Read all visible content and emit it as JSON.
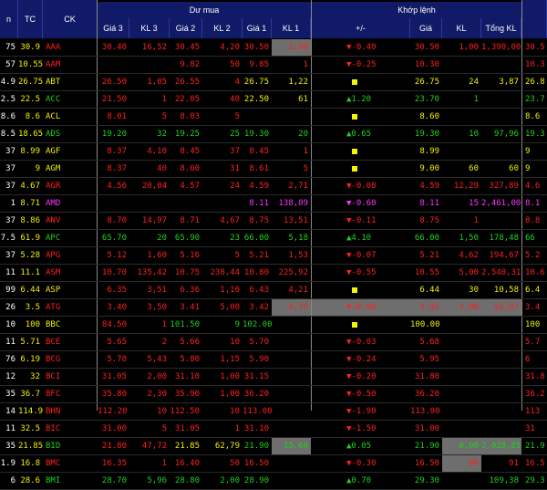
{
  "colors": {
    "up": "#1ed11e",
    "down": "#ff1f1f",
    "ref": "#f0f000",
    "ceil": "#ff33ff",
    "header_bg": "#111a66",
    "tc": "#f0f000"
  },
  "header": {
    "groups": {
      "buy": "Dư mua",
      "match": "Khớp lệnh"
    },
    "cols": {
      "prev": "n",
      "tc": "TC",
      "ck": "CK",
      "gia3": "Giá 3",
      "kl3": "KL 3",
      "gia2": "Giá 2",
      "kl2": "KL 2",
      "gia1": "Giá 1",
      "kl1": "KL 1",
      "change": "+/-",
      "gia": "Giá",
      "kl": "KL",
      "tongkl": "Tổng KL"
    }
  },
  "rows": [
    {
      "prev": "75",
      "tc": "30.9",
      "ck": "AAA",
      "gia3": "30.40",
      "kl3": "16,52",
      "gia2": "30.45",
      "kl2": "4,20",
      "gia1": "30.50",
      "kl1": "1,80",
      "change": "▼-0.40",
      "gia": "30.50",
      "kl": "1,00",
      "tongkl": "1,390,00",
      "right": "30.5",
      "hl": [
        "kl1"
      ],
      "tone": {
        "gia3": "down",
        "kl3": "down",
        "gia2": "down",
        "kl2": "down",
        "gia1": "down",
        "kl1": "down",
        "ck": "down",
        "change": "down",
        "gia": "down",
        "kl": "down",
        "tongkl": "down",
        "right": "down"
      }
    },
    {
      "prev": "57",
      "tc": "10.55",
      "ck": "AAM",
      "gia3": "",
      "kl3": "",
      "gia2": "9.82",
      "kl2": "50",
      "gia1": "9.85",
      "kl1": "1",
      "change": "▼-0.25",
      "gia": "10.30",
      "kl": "",
      "tongkl": "",
      "right": "10.3",
      "tone": {
        "gia2": "down",
        "kl2": "down",
        "gia1": "down",
        "kl1": "down",
        "ck": "down",
        "change": "down",
        "gia": "down",
        "kl": "down",
        "tongkl": "down",
        "right": "down"
      }
    },
    {
      "prev": "4.9",
      "tc": "26.75",
      "ck": "ABT",
      "gia3": "26.50",
      "kl3": "1,05",
      "gia2": "26.55",
      "kl2": "4",
      "gia1": "26.75",
      "kl1": "1,22",
      "change": "■",
      "gia": "26.75",
      "kl": "24",
      "tongkl": "3,87",
      "right": "26.8",
      "tone": {
        "gia3": "down",
        "kl3": "down",
        "gia2": "down",
        "kl2": "down",
        "gia1": "ref",
        "kl1": "ref",
        "ck": "ref",
        "change": "ref",
        "gia": "ref",
        "kl": "ref",
        "tongkl": "ref",
        "right": "ref"
      }
    },
    {
      "prev": "2.5",
      "tc": "22.5",
      "ck": "ACC",
      "gia3": "21.50",
      "kl3": "1",
      "gia2": "22.05",
      "kl2": "40",
      "gia1": "22.50",
      "kl1": "61",
      "change": "▲1.20",
      "gia": "23.70",
      "kl": "1",
      "tongkl": "",
      "right": "23.7",
      "tone": {
        "gia3": "down",
        "kl3": "down",
        "gia2": "down",
        "kl2": "down",
        "gia1": "ref",
        "kl1": "ref",
        "ck": "up",
        "change": "up",
        "gia": "up",
        "kl": "up",
        "tongkl": "up",
        "right": "up"
      }
    },
    {
      "prev": "8.6",
      "tc": "8.6",
      "ck": "ACL",
      "gia3": "8.01",
      "kl3": "5",
      "gia2": "8.03",
      "kl2": "5",
      "gia1": "",
      "kl1": "",
      "change": "■",
      "gia": "8.60",
      "kl": "",
      "tongkl": "",
      "right": "8.6",
      "tone": {
        "gia3": "down",
        "kl3": "down",
        "gia2": "down",
        "kl2": "down",
        "ck": "ref",
        "change": "ref",
        "gia": "ref",
        "kl": "ref",
        "tongkl": "ref",
        "right": "ref"
      }
    },
    {
      "prev": "8.5",
      "tc": "18.65",
      "ck": "ADS",
      "gia3": "19.20",
      "kl3": "32",
      "gia2": "19.25",
      "kl2": "25",
      "gia1": "19.30",
      "kl1": "20",
      "change": "▲0.65",
      "gia": "19.30",
      "kl": "10",
      "tongkl": "97,96",
      "right": "19.3",
      "tone": {
        "gia3": "up",
        "kl3": "up",
        "gia2": "up",
        "kl2": "up",
        "gia1": "up",
        "kl1": "up",
        "ck": "up",
        "change": "up",
        "gia": "up",
        "kl": "up",
        "tongkl": "up",
        "right": "up"
      }
    },
    {
      "prev": "37",
      "tc": "8.99",
      "ck": "AGF",
      "gia3": "8.37",
      "kl3": "4,10",
      "gia2": "8.45",
      "kl2": "37",
      "gia1": "8.45",
      "kl1": "1",
      "change": "■",
      "gia": "8.99",
      "kl": "",
      "tongkl": "",
      "right": "9",
      "tone": {
        "gia3": "down",
        "kl3": "down",
        "gia2": "down",
        "kl2": "down",
        "gia1": "down",
        "kl1": "down",
        "ck": "ref",
        "change": "ref",
        "gia": "ref",
        "kl": "ref",
        "tongkl": "ref",
        "right": "ref"
      }
    },
    {
      "prev": "37",
      "tc": "9",
      "ck": "AGM",
      "gia3": "8.37",
      "kl3": "40",
      "gia2": "8.60",
      "kl2": "31",
      "gia1": "8.61",
      "kl1": "5",
      "change": "■",
      "gia": "9.00",
      "kl": "60",
      "tongkl": "60",
      "right": "9",
      "tone": {
        "gia3": "down",
        "kl3": "down",
        "gia2": "down",
        "kl2": "down",
        "gia1": "down",
        "kl1": "down",
        "ck": "ref",
        "change": "ref",
        "gia": "ref",
        "kl": "ref",
        "tongkl": "ref",
        "right": "ref"
      }
    },
    {
      "prev": "37",
      "tc": "4.67",
      "ck": "AGR",
      "gia3": "4.56",
      "kl3": "20,04",
      "gia2": "4.57",
      "kl2": "24",
      "gia1": "4.59",
      "kl1": "2,71",
      "change": "▼-0.08",
      "gia": "4.59",
      "kl": "12,29",
      "tongkl": "327,89",
      "right": "4.6",
      "tone": {
        "gia3": "down",
        "kl3": "down",
        "gia2": "down",
        "kl2": "down",
        "gia1": "down",
        "kl1": "down",
        "ck": "down",
        "change": "down",
        "gia": "down",
        "kl": "down",
        "tongkl": "down",
        "right": "down"
      }
    },
    {
      "prev": "1",
      "tc": "8.71",
      "ck": "AMD",
      "gia3": "",
      "kl3": "",
      "gia2": "",
      "kl2": "",
      "gia1": "8.11",
      "kl1": "138,09",
      "change": "▼-0.60",
      "gia": "8.11",
      "kl": "15",
      "tongkl": "2,461,00",
      "right": "8.1",
      "tone": {
        "gia1": "ceil",
        "kl1": "ceil",
        "ck": "ceil",
        "change": "ceil",
        "gia": "ceil",
        "kl": "ceil",
        "tongkl": "ceil",
        "right": "ceil"
      }
    },
    {
      "prev": "37",
      "tc": "8.86",
      "ck": "ANV",
      "gia3": "8.70",
      "kl3": "14,97",
      "gia2": "8.71",
      "kl2": "4,67",
      "gia1": "8.75",
      "kl1": "13,51",
      "change": "▼-0.11",
      "gia": "8.75",
      "kl": "1",
      "tongkl": "",
      "right": "8.8",
      "tone": {
        "gia3": "down",
        "kl3": "down",
        "gia2": "down",
        "kl2": "down",
        "gia1": "down",
        "kl1": "down",
        "ck": "down",
        "change": "down",
        "gia": "down",
        "kl": "down",
        "tongkl": "down",
        "right": "down"
      }
    },
    {
      "prev": "7.5",
      "tc": "61.9",
      "ck": "APC",
      "gia3": "65.70",
      "kl3": "20",
      "gia2": "65.90",
      "kl2": "23",
      "gia1": "66.00",
      "kl1": "5,18",
      "change": "▲4.10",
      "gia": "66.00",
      "kl": "1,50",
      "tongkl": "178,48",
      "right": "66",
      "tone": {
        "gia3": "up",
        "kl3": "up",
        "gia2": "up",
        "kl2": "up",
        "gia1": "up",
        "kl1": "up",
        "ck": "up",
        "change": "up",
        "gia": "up",
        "kl": "up",
        "tongkl": "up",
        "right": "up"
      }
    },
    {
      "prev": "37",
      "tc": "5.28",
      "ck": "APG",
      "gia3": "5.12",
      "kl3": "1,60",
      "gia2": "5.16",
      "kl2": "5",
      "gia1": "5.21",
      "kl1": "1,53",
      "change": "▼-0.07",
      "gia": "5.21",
      "kl": "4,62",
      "tongkl": "194,67",
      "right": "5.2",
      "tone": {
        "gia3": "down",
        "kl3": "down",
        "gia2": "down",
        "kl2": "down",
        "gia1": "down",
        "kl1": "down",
        "ck": "down",
        "change": "down",
        "gia": "down",
        "kl": "down",
        "tongkl": "down",
        "right": "down"
      }
    },
    {
      "prev": "11",
      "tc": "11.1",
      "ck": "ASM",
      "gia3": "10.70",
      "kl3": "135,42",
      "gia2": "10.75",
      "kl2": "238,44",
      "gia1": "10.80",
      "kl1": "225,92",
      "change": "▼-0.55",
      "gia": "10.55",
      "kl": "5,00",
      "tongkl": "2,540,31",
      "right": "10.6",
      "tone": {
        "gia3": "down",
        "kl3": "down",
        "gia2": "down",
        "kl2": "down",
        "gia1": "down",
        "kl1": "down",
        "ck": "down",
        "change": "down",
        "gia": "down",
        "kl": "down",
        "tongkl": "down",
        "right": "down"
      }
    },
    {
      "prev": "99",
      "tc": "6.44",
      "ck": "ASP",
      "gia3": "6.35",
      "kl3": "3,51",
      "gia2": "6.36",
      "kl2": "1,10",
      "gia1": "6.43",
      "kl1": "4,21",
      "change": "■",
      "gia": "6.44",
      "kl": "30",
      "tongkl": "10,58",
      "right": "6.4",
      "tone": {
        "gia3": "down",
        "kl3": "down",
        "gia2": "down",
        "kl2": "down",
        "gia1": "down",
        "kl1": "down",
        "ck": "ref",
        "change": "ref",
        "gia": "ref",
        "kl": "ref",
        "tongkl": "ref",
        "right": "ref"
      }
    },
    {
      "prev": "26",
      "tc": "3.5",
      "ck": "ATG",
      "gia3": "3.40",
      "kl3": "3,50",
      "gia2": "3.41",
      "kl2": "5,00",
      "gia1": "3.42",
      "kl1": "4,75",
      "change": "▼-0.08",
      "gia": "3.42",
      "kl": "3,00",
      "tongkl": "52,97",
      "right": "3.4",
      "hl": [
        "kl1",
        "change",
        "gia",
        "kl",
        "tongkl"
      ],
      "tone": {
        "gia3": "down",
        "kl3": "down",
        "gia2": "down",
        "kl2": "down",
        "gia1": "down",
        "kl1": "down",
        "ck": "down",
        "change": "down",
        "gia": "down",
        "kl": "down",
        "tongkl": "down",
        "right": "down"
      }
    },
    {
      "prev": "10",
      "tc": "100",
      "ck": "BBC",
      "gia3": "84.50",
      "kl3": "1",
      "gia2": "101.50",
      "kl2": "9",
      "gia1": "102.00",
      "kl1": "",
      "change": "■",
      "gia": "100.00",
      "kl": "",
      "tongkl": "",
      "right": "100",
      "tone": {
        "gia3": "down",
        "kl3": "down",
        "gia2": "up",
        "kl2": "up",
        "gia1": "up",
        "kl1": "up",
        "ck": "ref",
        "change": "ref",
        "gia": "ref",
        "kl": "ref",
        "tongkl": "ref",
        "right": "ref"
      }
    },
    {
      "prev": "11",
      "tc": "5.71",
      "ck": "BCE",
      "gia3": "5.65",
      "kl3": "2",
      "gia2": "5.66",
      "kl2": "10",
      "gia1": "5.70",
      "kl1": "",
      "change": "▼-0.03",
      "gia": "5.68",
      "kl": "",
      "tongkl": "",
      "right": "5.7",
      "tone": {
        "gia3": "down",
        "kl3": "down",
        "gia2": "down",
        "kl2": "down",
        "gia1": "down",
        "kl1": "down",
        "ck": "down",
        "change": "down",
        "gia": "down",
        "kl": "down",
        "tongkl": "down",
        "right": "down"
      }
    },
    {
      "prev": "76",
      "tc": "6.19",
      "ck": "BCG",
      "gia3": "5.78",
      "kl3": "5,43",
      "gia2": "5.80",
      "kl2": "1,15",
      "gia1": "5.90",
      "kl1": "",
      "change": "▼-0.24",
      "gia": "5.95",
      "kl": "",
      "tongkl": "",
      "right": "6",
      "tone": {
        "gia3": "down",
        "kl3": "down",
        "gia2": "down",
        "kl2": "down",
        "gia1": "down",
        "kl1": "down",
        "ck": "down",
        "change": "down",
        "gia": "down",
        "kl": "down",
        "tongkl": "down",
        "right": "down"
      }
    },
    {
      "prev": "12",
      "tc": "32",
      "ck": "BCI",
      "gia3": "31.05",
      "kl3": "2,00",
      "gia2": "31.10",
      "kl2": "1,00",
      "gia1": "31.15",
      "kl1": "",
      "change": "▼-0.20",
      "gia": "31.80",
      "kl": "",
      "tongkl": "",
      "right": "31.8",
      "tone": {
        "gia3": "down",
        "kl3": "down",
        "gia2": "down",
        "kl2": "down",
        "gia1": "down",
        "kl1": "down",
        "ck": "down",
        "change": "down",
        "gia": "down",
        "kl": "down",
        "tongkl": "down",
        "right": "down"
      }
    },
    {
      "prev": "35",
      "tc": "36.7",
      "ck": "BFC",
      "gia3": "35.80",
      "kl3": "2,30",
      "gia2": "35.90",
      "kl2": "1,00",
      "gia1": "36.20",
      "kl1": "",
      "change": "▼-0.50",
      "gia": "36.20",
      "kl": "",
      "tongkl": "",
      "right": "36.2",
      "tone": {
        "gia3": "down",
        "kl3": "down",
        "gia2": "down",
        "kl2": "down",
        "gia1": "down",
        "kl1": "down",
        "ck": "down",
        "change": "down",
        "gia": "down",
        "kl": "down",
        "tongkl": "down",
        "right": "down"
      }
    },
    {
      "prev": "14",
      "tc": "114.9",
      "ck": "BHN",
      "gia3": "112.20",
      "kl3": "10",
      "gia2": "112.50",
      "kl2": "10",
      "gia1": "113.00",
      "kl1": "",
      "change": "▼-1.90",
      "gia": "113.00",
      "kl": "",
      "tongkl": "",
      "right": "113",
      "tone": {
        "gia3": "down",
        "kl3": "down",
        "gia2": "down",
        "kl2": "down",
        "gia1": "down",
        "kl1": "down",
        "ck": "down",
        "change": "down",
        "gia": "down",
        "kl": "down",
        "tongkl": "down",
        "right": "down"
      }
    },
    {
      "prev": "11",
      "tc": "32.5",
      "ck": "BIC",
      "gia3": "31.00",
      "kl3": "5",
      "gia2": "31.05",
      "kl2": "1",
      "gia1": "31.10",
      "kl1": "",
      "change": "▼-1.50",
      "gia": "31.00",
      "kl": "",
      "tongkl": "",
      "right": "31",
      "tone": {
        "gia3": "down",
        "kl3": "down",
        "gia2": "down",
        "kl2": "down",
        "gia1": "down",
        "kl1": "down",
        "ck": "down",
        "change": "down",
        "gia": "down",
        "kl": "down",
        "tongkl": "down",
        "right": "down"
      }
    },
    {
      "prev": "35",
      "tc": "21.85",
      "ck": "BID",
      "gia3": "21.80",
      "kl3": "47,72",
      "gia2": "21.85",
      "kl2": "62,79",
      "gia1": "21.90",
      "kl1": "15,66",
      "change": "▲0.05",
      "gia": "21.90",
      "kl": "8,00",
      "tongkl": "2,028,85",
      "right": "21.9",
      "hl": [
        "kl1",
        "kl",
        "tongkl"
      ],
      "tone": {
        "gia3": "down",
        "kl3": "down",
        "gia2": "ref",
        "kl2": "ref",
        "gia1": "up",
        "kl1": "up",
        "ck": "up",
        "change": "up",
        "gia": "up",
        "kl": "up",
        "tongkl": "up",
        "right": "up"
      }
    },
    {
      "prev": "1.9",
      "tc": "16.8",
      "ck": "BMC",
      "gia3": "16.35",
      "kl3": "1",
      "gia2": "16.40",
      "kl2": "50",
      "gia1": "16.50",
      "kl1": "",
      "change": "▼-0.30",
      "gia": "16.50",
      "kl": "80",
      "tongkl": "91",
      "right": "16.5",
      "hl": [
        "kl"
      ],
      "tone": {
        "gia3": "down",
        "kl3": "down",
        "gia2": "down",
        "kl2": "down",
        "gia1": "down",
        "kl1": "down",
        "ck": "down",
        "change": "down",
        "gia": "down",
        "kl": "down",
        "tongkl": "down",
        "right": "down"
      }
    },
    {
      "prev": "6",
      "tc": "28.6",
      "ck": "BMI",
      "gia3": "28.70",
      "kl3": "5,96",
      "gia2": "28.80",
      "kl2": "2,00",
      "gia1": "28.90",
      "kl1": "",
      "change": "▲0.70",
      "gia": "29.30",
      "kl": "",
      "tongkl": "109,38",
      "right": "29.3",
      "tone": {
        "gia3": "up",
        "kl3": "up",
        "gia2": "up",
        "kl2": "up",
        "gia1": "up",
        "kl1": "up",
        "ck": "up",
        "change": "up",
        "gia": "up",
        "kl": "up",
        "tongkl": "up",
        "right": "up"
      }
    }
  ]
}
